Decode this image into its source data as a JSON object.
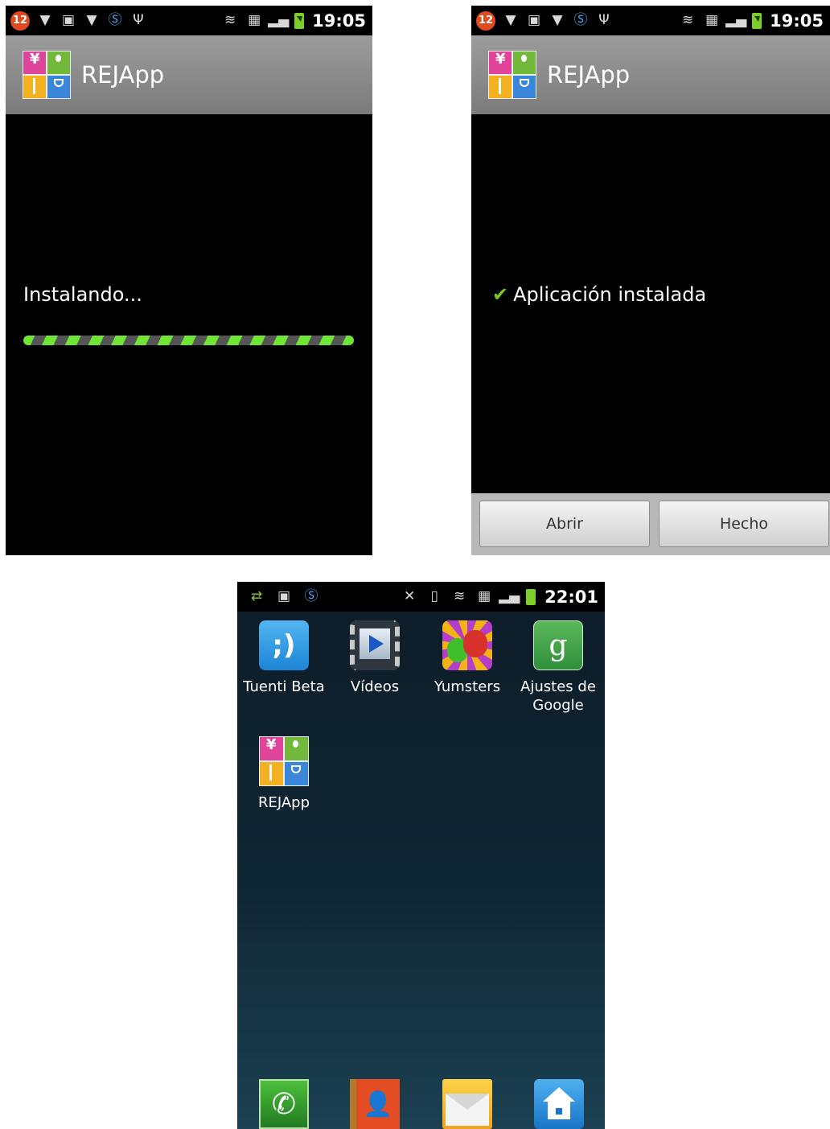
{
  "screens": {
    "installing": {
      "status": {
        "notification_count": "12",
        "time": "19:05"
      },
      "app_title": "REJApp",
      "message": "Instalando...",
      "progress_icons": "striped-indeterminate-progress"
    },
    "installed": {
      "status": {
        "notification_count": "12",
        "time": "19:05"
      },
      "app_title": "REJApp",
      "message": "Aplicación instalada",
      "buttons": {
        "open": "Abrir",
        "done": "Hecho"
      },
      "accent": "#78c81e"
    },
    "home": {
      "status": {
        "time": "22:01"
      },
      "apps": [
        {
          "label": "Tuenti Beta",
          "icon": "tuenti-icon"
        },
        {
          "label": "Vídeos",
          "icon": "videos-icon"
        },
        {
          "label": "Yumsters",
          "icon": "yumsters-icon"
        },
        {
          "label": "Ajustes de Google",
          "icon": "google-settings-icon"
        },
        {
          "label": "REJApp",
          "icon": "rejapp-icon"
        }
      ],
      "dock": [
        "phone-icon",
        "contacts-icon",
        "messages-icon",
        "home-icon"
      ]
    }
  },
  "colors": {
    "progress_green": "#6fe633",
    "titlebar": "#8c8c8c",
    "badge": "#e04a1c",
    "battery": "#7ccf2a"
  }
}
